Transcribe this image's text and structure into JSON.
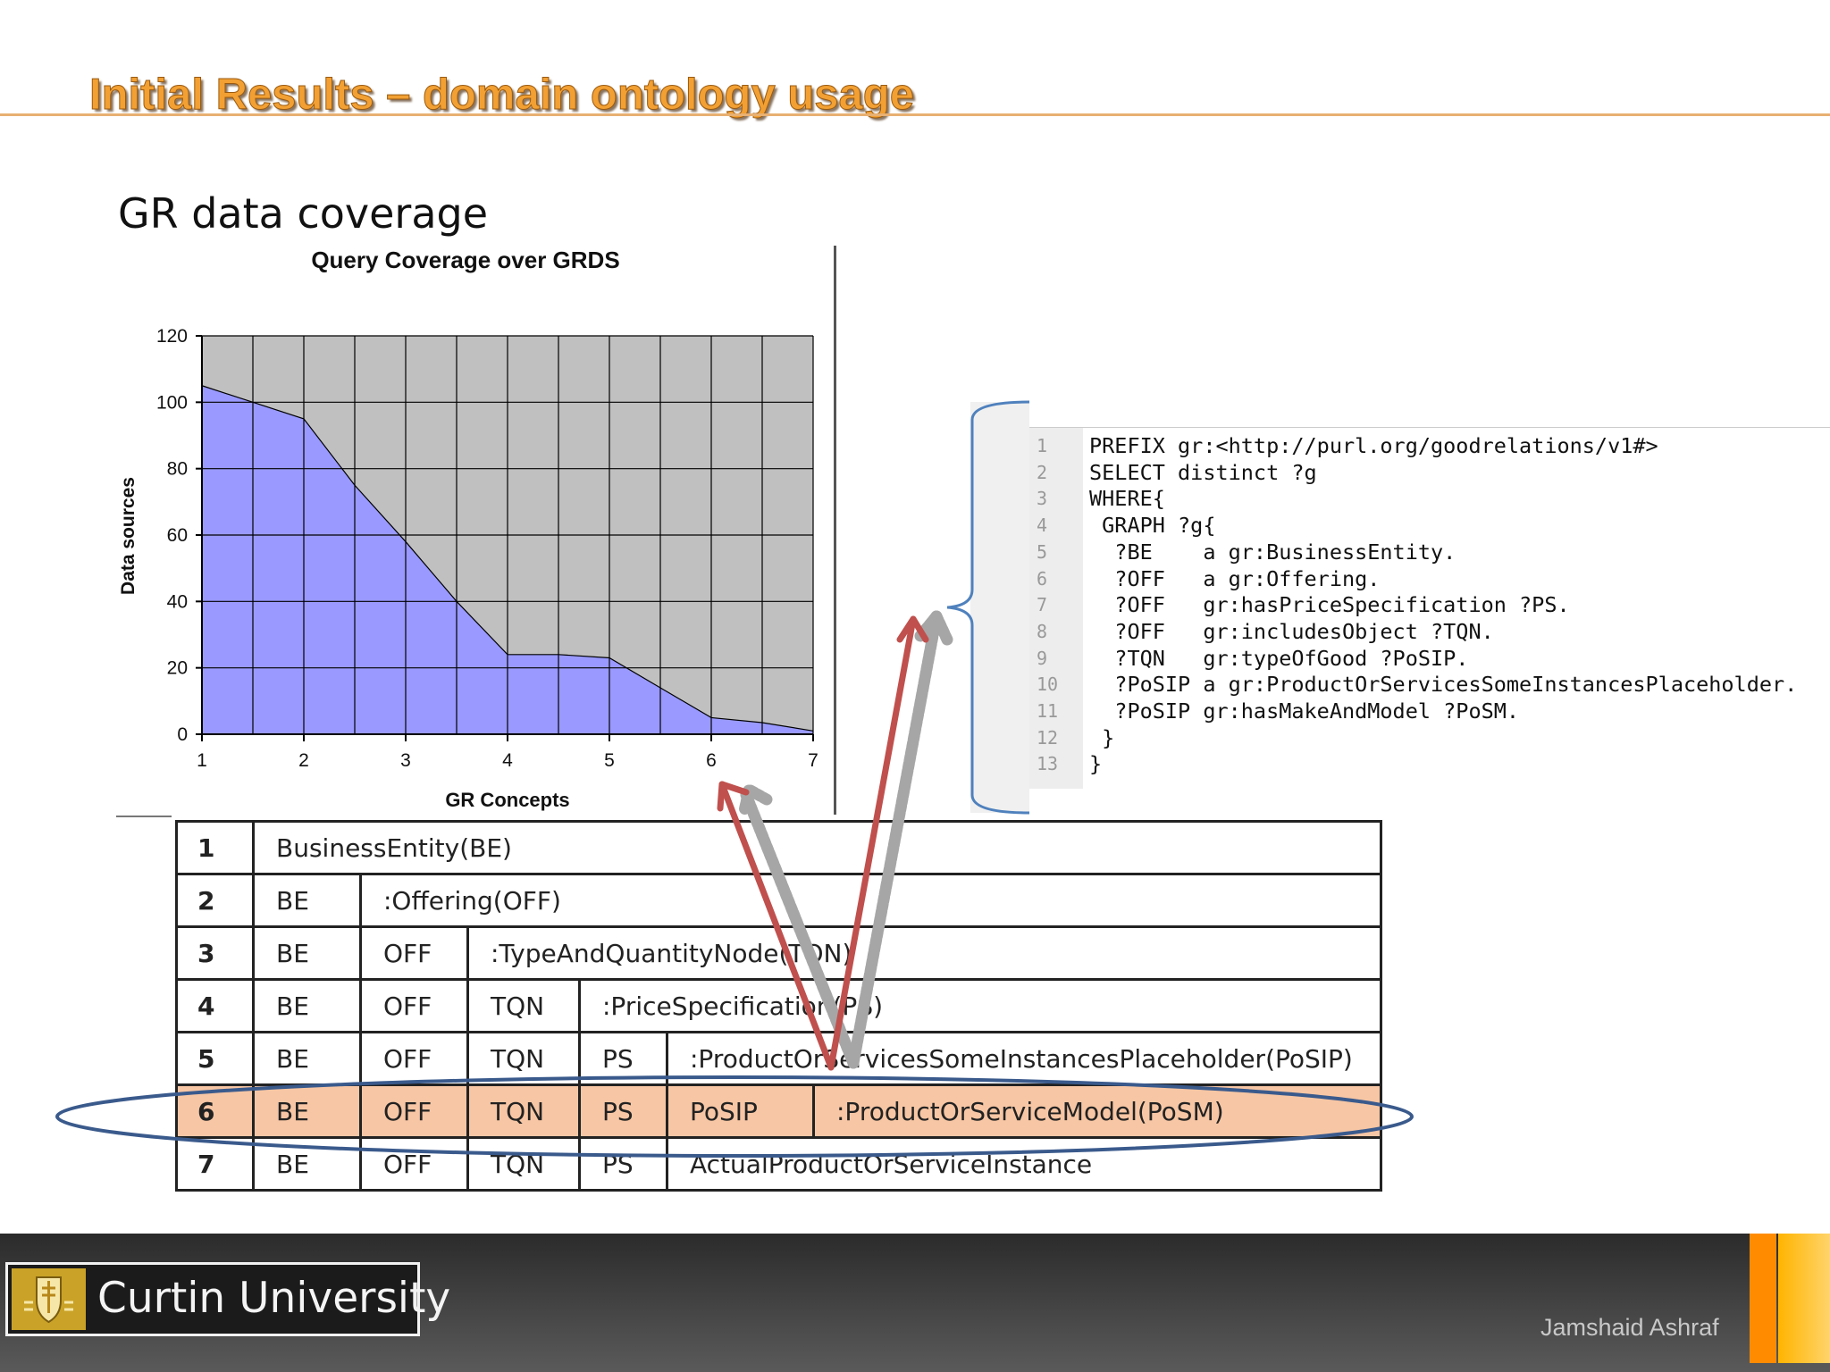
{
  "slide": {
    "title": "Initial Results – domain ontology usage",
    "subtitle": "GR data coverage",
    "author": "Jamshaid Ashraf",
    "logo_text": "Curtin University"
  },
  "chart_data": {
    "type": "area",
    "title": "Query Coverage over GRDS",
    "xlabel": "GR Concepts",
    "ylabel": "Data sources",
    "x": [
      1,
      1.5,
      2,
      2.5,
      3,
      3.5,
      4,
      4.5,
      5,
      5.5,
      6,
      6.5,
      7
    ],
    "y": [
      105,
      100,
      95,
      75,
      58,
      40,
      24,
      24,
      23,
      14,
      5,
      3.5,
      1
    ],
    "xlim": [
      1,
      7
    ],
    "ylim": [
      0,
      120
    ],
    "xticks": [
      1,
      2,
      3,
      4,
      5,
      6,
      7
    ],
    "yticks": [
      0,
      20,
      40,
      60,
      80,
      100,
      120
    ],
    "fill_color": "#9999ff",
    "plot_background": "#c0c0c0",
    "grid": true
  },
  "code": [
    {
      "ln": "1",
      "text": "PREFIX gr:<http://purl.org/goodrelations/v1#>"
    },
    {
      "ln": "2",
      "text": "SELECT distinct ?g"
    },
    {
      "ln": "3",
      "text": "WHERE{"
    },
    {
      "ln": "4",
      "text": " GRAPH ?g{"
    },
    {
      "ln": "5",
      "text": "  ?BE    a gr:BusinessEntity."
    },
    {
      "ln": "6",
      "text": "  ?OFF   a gr:Offering."
    },
    {
      "ln": "7",
      "text": "  ?OFF   gr:hasPriceSpecification ?PS."
    },
    {
      "ln": "8",
      "text": "  ?OFF   gr:includesObject ?TQN."
    },
    {
      "ln": "9",
      "text": "  ?TQN   gr:typeOfGood ?PoSIP."
    },
    {
      "ln": "10",
      "text": "  ?PoSIP a gr:ProductOrServicesSomeInstancesPlaceholder."
    },
    {
      "ln": "11",
      "text": "  ?PoSIP gr:hasMakeAndModel ?PoSM."
    },
    {
      "ln": "12",
      "text": " }"
    },
    {
      "ln": "13",
      "text": "}"
    }
  ],
  "table": {
    "rows": [
      [
        "1",
        "BusinessEntity(BE)"
      ],
      [
        "2",
        "BE",
        ":Offering(OFF)"
      ],
      [
        "3",
        "BE",
        "OFF",
        ":TypeAndQuantityNode(TQN)"
      ],
      [
        "4",
        "BE",
        "OFF",
        "TQN",
        ":PriceSpecification(PS)"
      ],
      [
        "5",
        "BE",
        "OFF",
        "TQN",
        "PS",
        ":ProductOrServicesSomeInstancesPlaceholder(PoSIP)"
      ],
      [
        "6",
        "BE",
        "OFF",
        "TQN",
        "PS",
        "PoSIP",
        ":ProductOrServiceModel(PoSM)"
      ],
      [
        "7",
        "BE",
        "OFF",
        "TQN",
        "PS",
        "ActualProductOrServiceInstance"
      ]
    ],
    "highlighted_row": 6,
    "highlight_color": "#f7c6a4"
  },
  "colors": {
    "title": "#f2a033",
    "arrow_red": "#c0504d",
    "arrow_gray": "#a6a6a6",
    "ellipse": "#3a5a8c",
    "brace": "#4f81bd"
  }
}
